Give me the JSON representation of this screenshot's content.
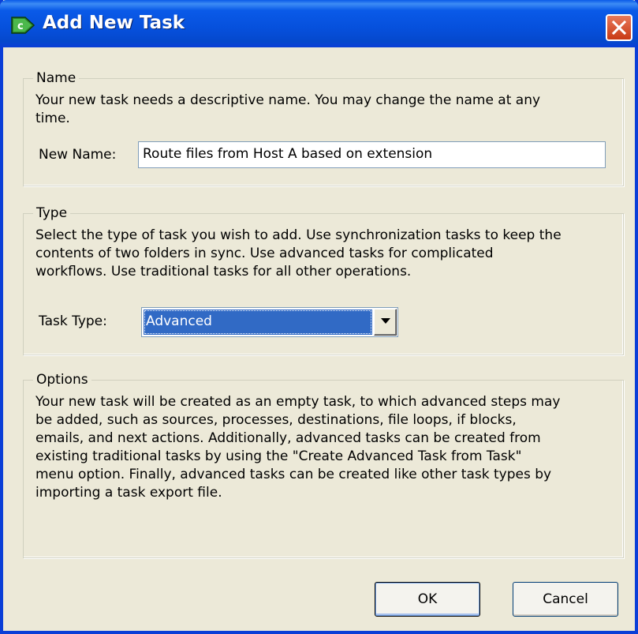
{
  "window": {
    "title": "Add New Task"
  },
  "name_group": {
    "legend": "Name",
    "description_lines": [
      "Your new task needs a descriptive name.  You may change the name at any",
      "time."
    ],
    "field_label": "New Name:",
    "field_value": "Route files from Host A based on extension"
  },
  "type_group": {
    "legend": "Type",
    "description_lines": [
      "Select the type of task you wish to add. Use synchronization tasks to keep the",
      "contents of two folders in sync. Use advanced tasks for complicated",
      "workflows. Use traditional tasks for all other operations."
    ],
    "field_label": "Task Type:",
    "selected": "Advanced"
  },
  "options_group": {
    "legend": "Options",
    "description_lines": [
      "Your new task will be created as an empty task, to which advanced steps may",
      "be added, such as sources, processes, destinations, file loops, if blocks,",
      "emails, and next actions. Additionally, advanced tasks can be created from",
      "existing traditional tasks by using the \"Create Advanced Task from Task\"",
      "menu option. Finally, advanced tasks can be created like other task types by",
      "importing a task export file."
    ]
  },
  "buttons": {
    "ok": "OK",
    "cancel": "Cancel"
  },
  "icons": {
    "app": "app-icon",
    "close": "close-icon",
    "dropdown": "chevron-down-icon"
  },
  "colors": {
    "titlebar": "#0a5ae8",
    "dialog_bg": "#ece9d8",
    "selection": "#316ac5",
    "close": "#d9542b"
  }
}
